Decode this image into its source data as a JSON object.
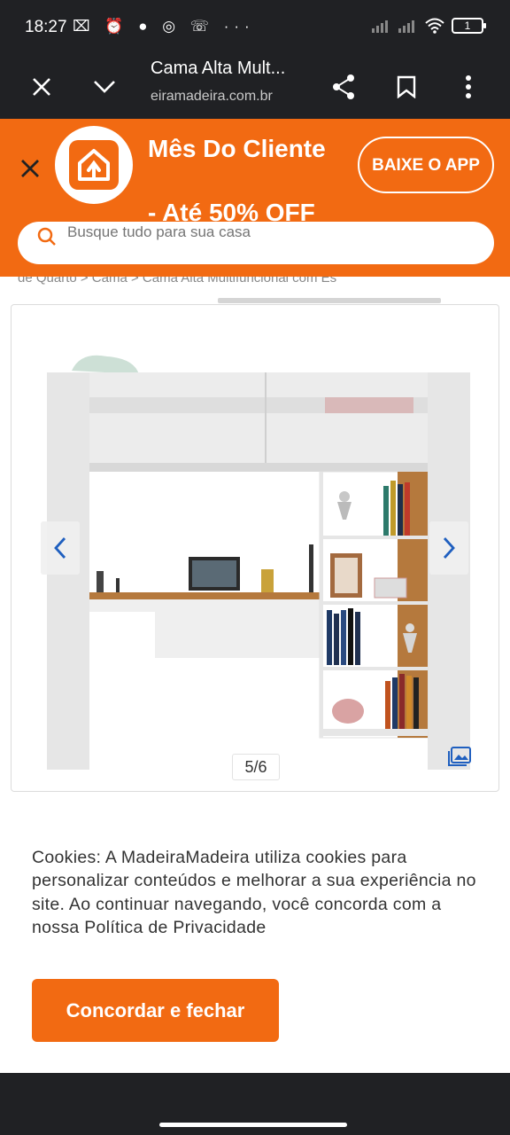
{
  "status_bar": {
    "time": "18:27",
    "left_icons": "⌧ ⏰ ● ◎ ☏ ···",
    "battery": "1",
    "right_icons": [
      "signal-icon",
      "signal-icon",
      "wifi-icon",
      "battery-icon"
    ]
  },
  "browser": {
    "title": "Cama Alta Mult...",
    "url": "eiramadeira.com.br"
  },
  "promo": {
    "title": "Mês Do Cliente",
    "subtitle": "- Até 50% OFF",
    "button": "BAIXE O APP"
  },
  "search": {
    "placeholder": "Busque tudo para sua casa"
  },
  "breadcrumb": "de Quarto  >  Cama  >  Cama Alta Multifuncional com Es",
  "gallery": {
    "counter": "5/6"
  },
  "cookies": {
    "text": "Cookies: A MadeiraMadeira utiliza cookies para personalizar conteúdos e melhorar a sua experiência no site. Ao continuar navegando, você concorda com a nossa Política de Privacidade",
    "button": "Concordar e fechar"
  },
  "colors": {
    "brand": "#f26a12",
    "system_bar": "#202124",
    "link": "#1f5fbf"
  }
}
